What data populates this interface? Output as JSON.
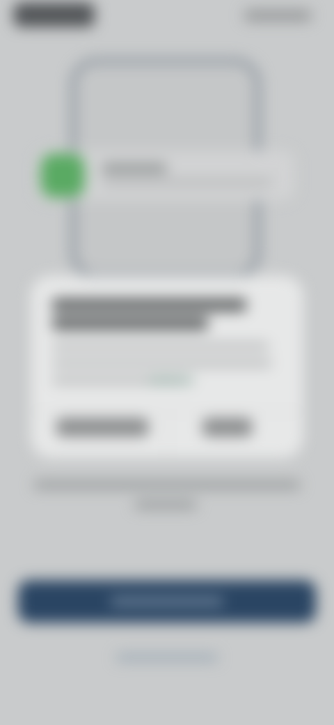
{
  "top_bar": {
    "left": "",
    "right": ""
  },
  "phone": {
    "notification_title": "",
    "notification_text": ""
  },
  "dialog": {
    "title": "",
    "body": "",
    "link": "",
    "left_button": "",
    "right_button": ""
  },
  "info_text": "",
  "primary_button": {
    "label": ""
  },
  "secondary_link": {
    "label": ""
  },
  "colors": {
    "background": "#c9cbcc",
    "primary": "#2a4563",
    "notification_icon": "#5aaa63"
  },
  "icons": {
    "notification_app": "app-icon"
  }
}
